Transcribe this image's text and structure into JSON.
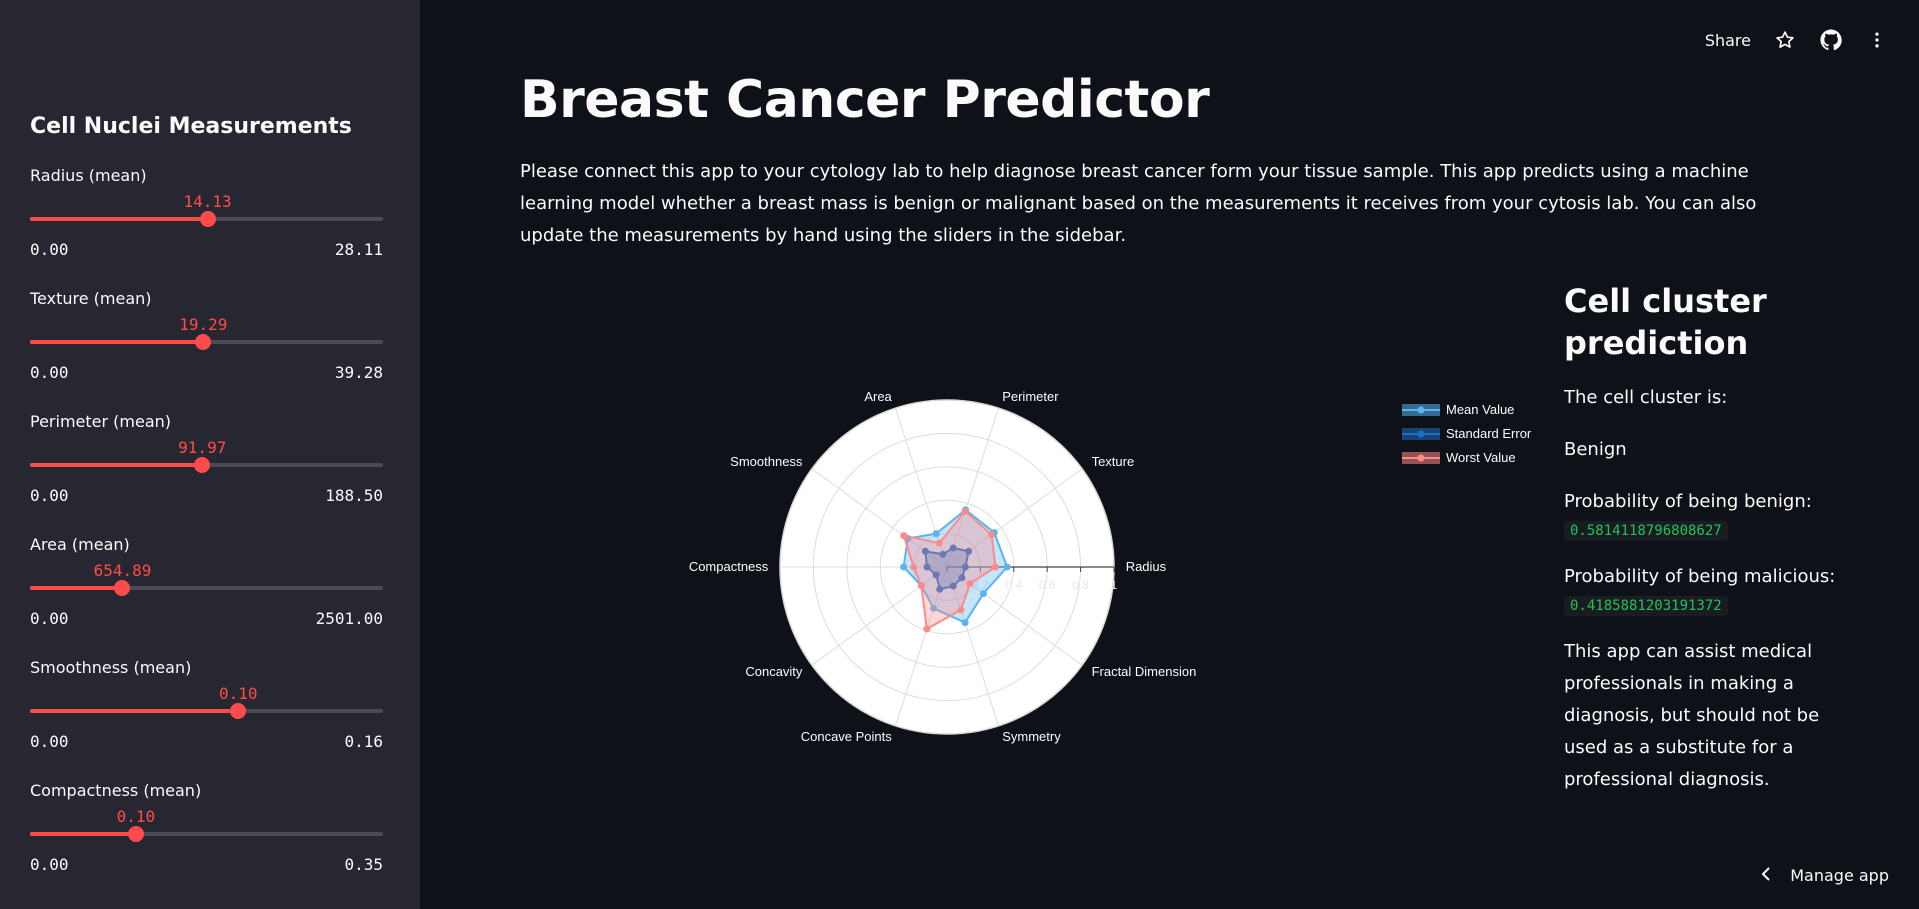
{
  "sidebar": {
    "title": "Cell Nuclei Measurements",
    "sliders": [
      {
        "label": "Radius (mean)",
        "value": "14.13",
        "min": "0.00",
        "max": "28.11",
        "fraction": 0.503
      },
      {
        "label": "Texture (mean)",
        "value": "19.29",
        "min": "0.00",
        "max": "39.28",
        "fraction": 0.491
      },
      {
        "label": "Perimeter (mean)",
        "value": "91.97",
        "min": "0.00",
        "max": "188.50",
        "fraction": 0.488
      },
      {
        "label": "Area (mean)",
        "value": "654.89",
        "min": "0.00",
        "max": "2501.00",
        "fraction": 0.262
      },
      {
        "label": "Smoothness (mean)",
        "value": "0.10",
        "min": "0.00",
        "max": "0.16",
        "fraction": 0.59
      },
      {
        "label": "Compactness (mean)",
        "value": "0.10",
        "min": "0.00",
        "max": "0.35",
        "fraction": 0.3
      }
    ]
  },
  "header": {
    "share_label": "Share",
    "icons": [
      "star-icon",
      "github-icon",
      "more-vertical-icon"
    ]
  },
  "main": {
    "title": "Breast Cancer Predictor",
    "intro": "Please connect this app to your cytology lab to help diagnose breast cancer form your tissue sample. This app predicts using a machine learning model whether a breast mass is benign or malignant based on the measurements it receives from your cytosis lab. You can also update the measurements by hand using the sliders in the sidebar."
  },
  "chart_data": {
    "type": "radar",
    "categories": [
      "Radius",
      "Texture",
      "Perimeter",
      "Area",
      "Smoothness",
      "Compactness",
      "Concavity",
      "Concave Points",
      "Symmetry",
      "Fractal Dimension"
    ],
    "radial_ticks": [
      "0",
      "0.2",
      "0.4",
      "0.6",
      "0.8",
      "1"
    ],
    "range": [
      0,
      1
    ],
    "legend_position": "top-right",
    "series": [
      {
        "name": "Mean Value",
        "color": "#5ab4f0",
        "values": [
          0.36,
          0.35,
          0.36,
          0.21,
          0.29,
          0.26,
          0.19,
          0.26,
          0.35,
          0.27
        ]
      },
      {
        "name": "Standard Error",
        "color": "#1f6fc7",
        "values": [
          0.11,
          0.16,
          0.12,
          0.08,
          0.16,
          0.12,
          0.08,
          0.14,
          0.12,
          0.11
        ]
      },
      {
        "name": "Worst Value",
        "color": "#ff8a8a",
        "values": [
          0.29,
          0.33,
          0.35,
          0.15,
          0.32,
          0.2,
          0.19,
          0.39,
          0.27,
          0.17
        ]
      }
    ]
  },
  "prediction": {
    "heading": "Cell cluster prediction",
    "cluster_label": "The cell cluster is:",
    "cluster_value": "Benign",
    "benign_label": "Probability of being benign:",
    "benign_value": "0.5814118796808627",
    "malicious_label": "Probability of being malicious:",
    "malicious_value": "0.4185881203191372",
    "disclaimer": "This app can assist medical professionals in making a diagnosis, but should not be used as a substitute for a professional diagnosis."
  },
  "footer": {
    "manage_label": "Manage app"
  },
  "colors": {
    "accent": "#ff4b4b",
    "background": "#0e1117",
    "sidebar": "#262730",
    "code_text": "#21c354"
  }
}
